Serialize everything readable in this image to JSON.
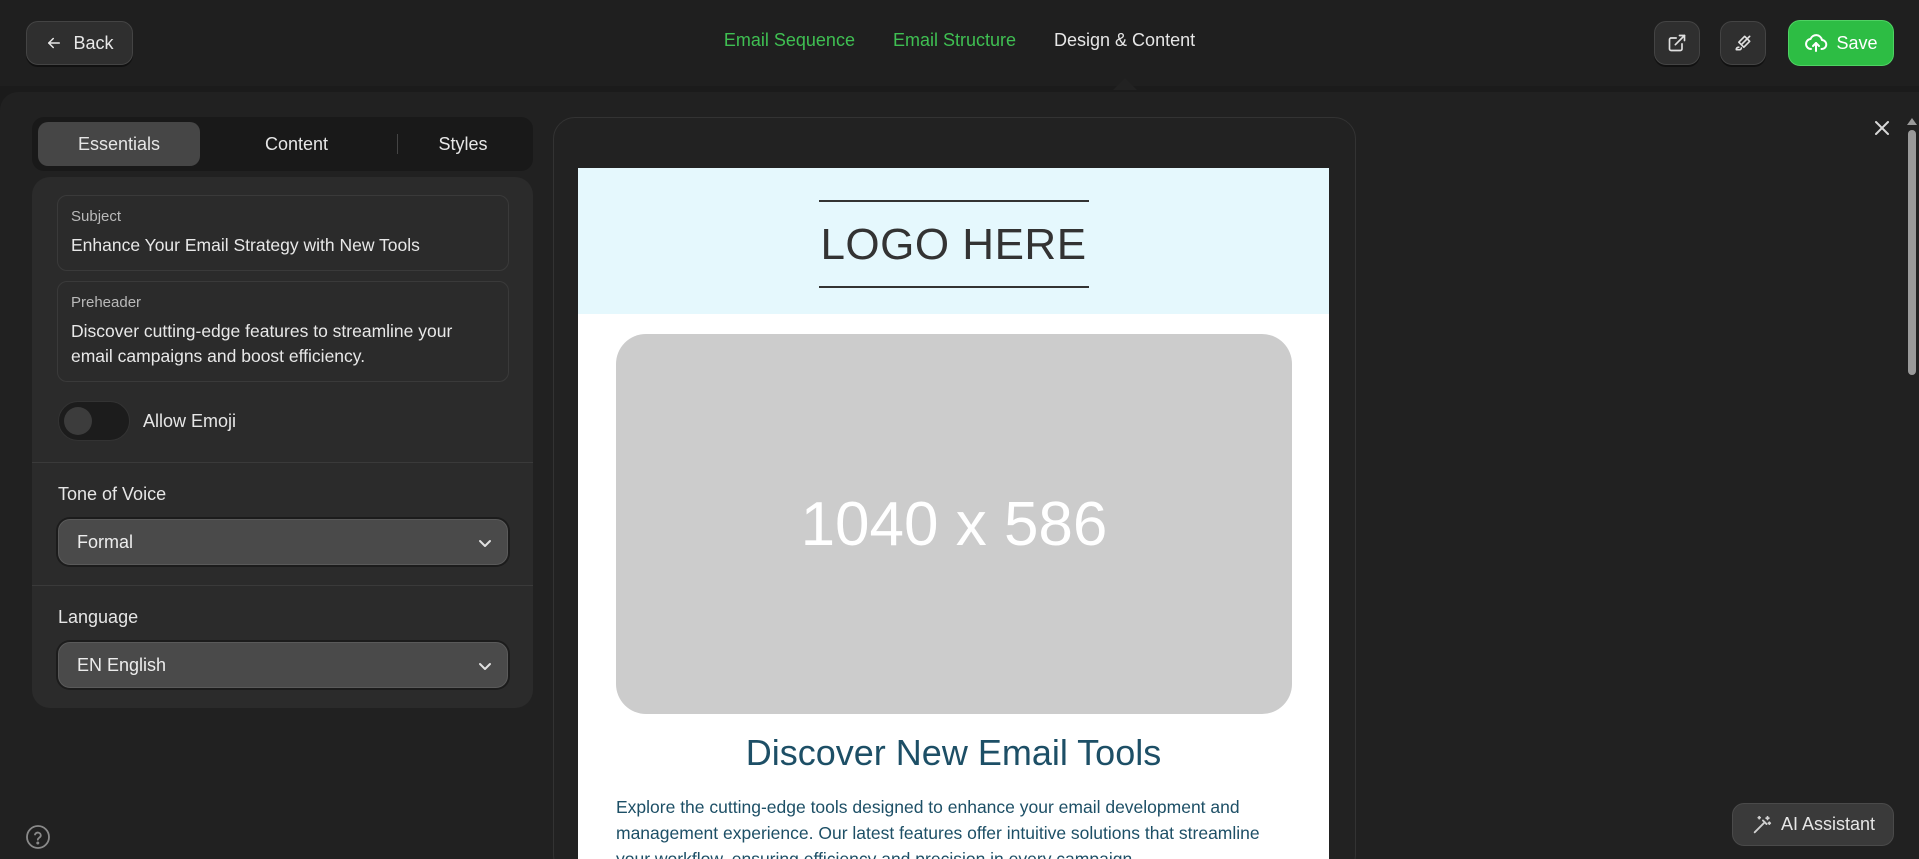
{
  "header": {
    "back_label": "Back",
    "steps": [
      {
        "label": "Email Sequence",
        "state": "done"
      },
      {
        "label": "Email Structure",
        "state": "done"
      },
      {
        "label": "Design & Content",
        "state": "active"
      }
    ],
    "save_label": "Save",
    "icons": [
      "arrow-left-icon",
      "external-link-icon",
      "brush-icon",
      "cloud-upload-icon"
    ]
  },
  "sidebar": {
    "tabs": [
      {
        "label": "Essentials",
        "active": true
      },
      {
        "label": "Content",
        "active": false
      },
      {
        "label": "Styles",
        "active": false
      }
    ],
    "subject": {
      "label": "Subject",
      "value": "Enhance Your Email Strategy with New Tools"
    },
    "preheader": {
      "label": "Preheader",
      "value": "Discover cutting-edge features to streamline your email campaigns and boost efficiency."
    },
    "allow_emoji": {
      "label": "Allow Emoji",
      "enabled": false
    },
    "tone": {
      "label": "Tone of Voice",
      "value": "Formal"
    },
    "language": {
      "label": "Language",
      "value": "EN English"
    }
  },
  "preview": {
    "logo_text": "LOGO HERE",
    "hero_placeholder": "1040 x 586",
    "title": "Discover New Email Tools",
    "body": "Explore the cutting-edge tools designed to enhance your email development and management experience. Our latest features offer intuitive solutions that streamline your workflow, ensuring efficiency and precision in every campaign."
  },
  "ai_assistant_label": "AI Assistant",
  "colors": {
    "accent_green": "#2dbd44",
    "step_done": "#3fbf52",
    "email_header_bg": "#e5f8fd",
    "email_text": "#1d4f66"
  }
}
